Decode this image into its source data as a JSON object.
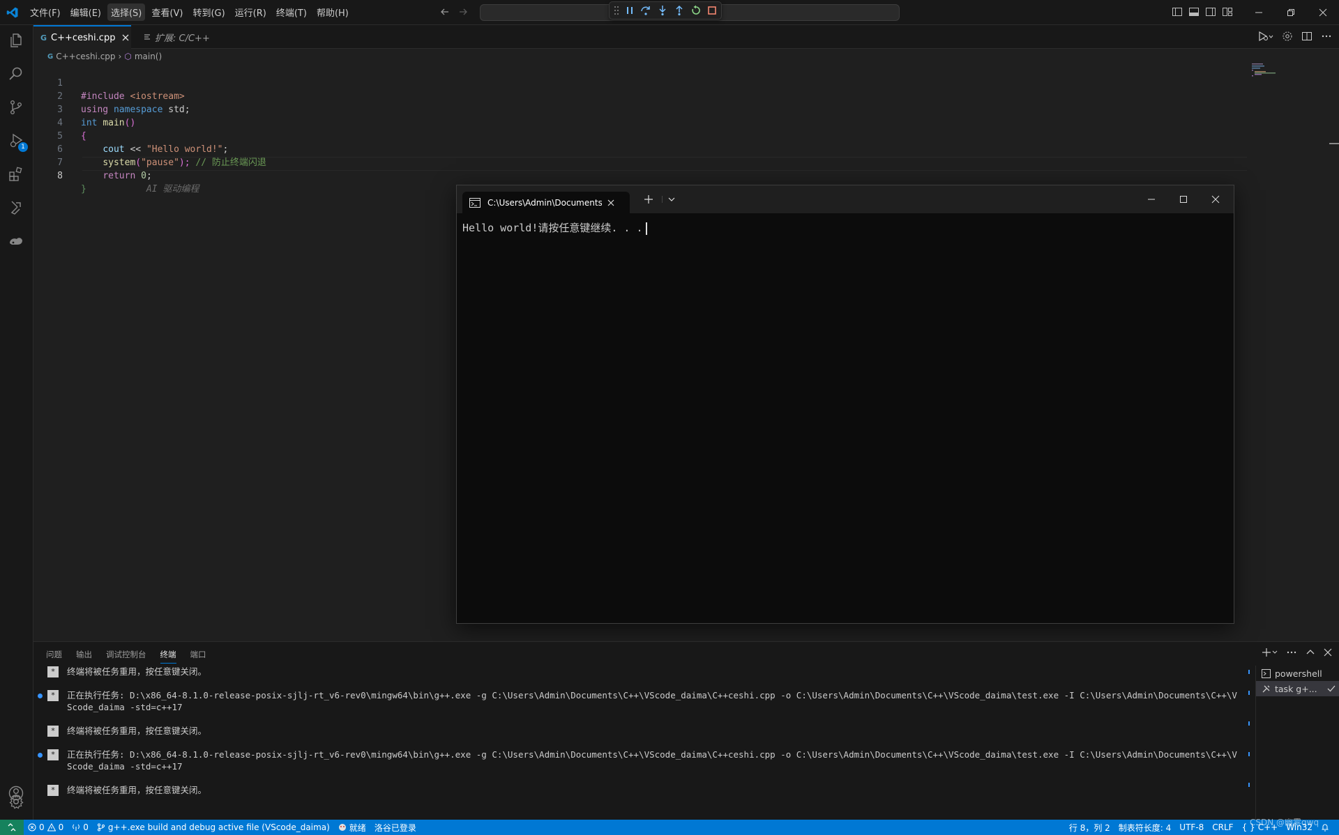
{
  "titlebar": {
    "menus": [
      "文件(F)",
      "编辑(E)",
      "选择(S)",
      "查看(V)",
      "转到(G)",
      "运行(R)",
      "终端(T)",
      "帮助(H)"
    ],
    "active_menu_index": 2
  },
  "editor": {
    "tabs": [
      {
        "label": "C++ceshi.cpp",
        "active": true,
        "icon": "cpp-file-icon"
      },
      {
        "label": "扩展: C/C++",
        "active": false,
        "icon": "extension-preview-icon"
      }
    ],
    "breadcrumb": {
      "file": "C++ceshi.cpp",
      "symbol": "main()"
    },
    "line_numbers": [
      "1",
      "2",
      "3",
      "4",
      "5",
      "6",
      "7",
      "8"
    ],
    "code": {
      "l1_directive": "#include ",
      "l1_header": "<iostream>",
      "l2_kw1": "using",
      "l2_kw2": "namespace",
      "l2_rest": " std;",
      "l3_type": "int",
      "l3_fn": "main",
      "l3_parens": "()",
      "l4_brace": "{",
      "l5_var": "cout",
      "l5_op": " << ",
      "l5_str": "\"Hello world!\"",
      "l5_end": ";",
      "l6_fn": "system",
      "l6_open": "(",
      "l6_str": "\"pause\"",
      "l6_close": ");",
      "l6_comment": "// 防止终端闪退",
      "l7_kw": "return",
      "l7_num": "0",
      "l7_end": ";",
      "l8_brace": "}",
      "l8_ghost": "AI 驱动编程"
    }
  },
  "external_terminal": {
    "tab_title": "C:\\Users\\Admin\\Documents\\C",
    "output": "Hello world!请按任意键继续. . ."
  },
  "panel": {
    "tabs": [
      "问题",
      "输出",
      "调试控制台",
      "终端",
      "端口"
    ],
    "active_tab_index": 3,
    "lines": [
      {
        "dot": false,
        "text": "终端将被任务重用，按任意键关闭。"
      },
      {
        "dot": true,
        "text": "正在执行任务: D:\\x86_64-8.1.0-release-posix-sjlj-rt_v6-rev0\\mingw64\\bin\\g++.exe -g C:\\Users\\Admin\\Documents\\C++\\VScode_daima\\C++ceshi.cpp -o C:\\Users\\Admin\\Documents\\C++\\VScode_daima\\test.exe -I C:\\Users\\Admin\\Documents\\C++\\VScode_daima -std=c++17"
      },
      {
        "dot": false,
        "text": "终端将被任务重用，按任意键关闭。"
      },
      {
        "dot": true,
        "text": "正在执行任务: D:\\x86_64-8.1.0-release-posix-sjlj-rt_v6-rev0\\mingw64\\bin\\g++.exe -g C:\\Users\\Admin\\Documents\\C++\\VScode_daima\\C++ceshi.cpp -o C:\\Users\\Admin\\Documents\\C++\\VScode_daima\\test.exe -I C:\\Users\\Admin\\Documents\\C++\\VScode_daima -std=c++17"
      },
      {
        "dot": false,
        "text": "终端将被任务重用，按任意键关闭。"
      }
    ],
    "terminal_list": [
      {
        "label": "powershell",
        "icon": "terminal-icon"
      },
      {
        "label": "task g+...",
        "icon": "tools-icon"
      }
    ]
  },
  "activity_badge": "1",
  "statusbar": {
    "errors": "0",
    "warnings": "0",
    "ports": "0",
    "task": "g++.exe build and debug active file (VScode_daima)",
    "ready": "就绪",
    "login": "洛谷已登录",
    "position": "行 8，列 2",
    "tab_size": "制表符长度: 4",
    "encoding": "UTF-8",
    "eol": "CRLF",
    "language": "C++",
    "platform": "Win32"
  },
  "watermark": "CSDN @幽雾qwq",
  "colors": {
    "accent": "#0078d4",
    "editor_bg": "#1f1f1f",
    "chrome_bg": "#181818",
    "terminal_bg": "#0c0c0c"
  }
}
